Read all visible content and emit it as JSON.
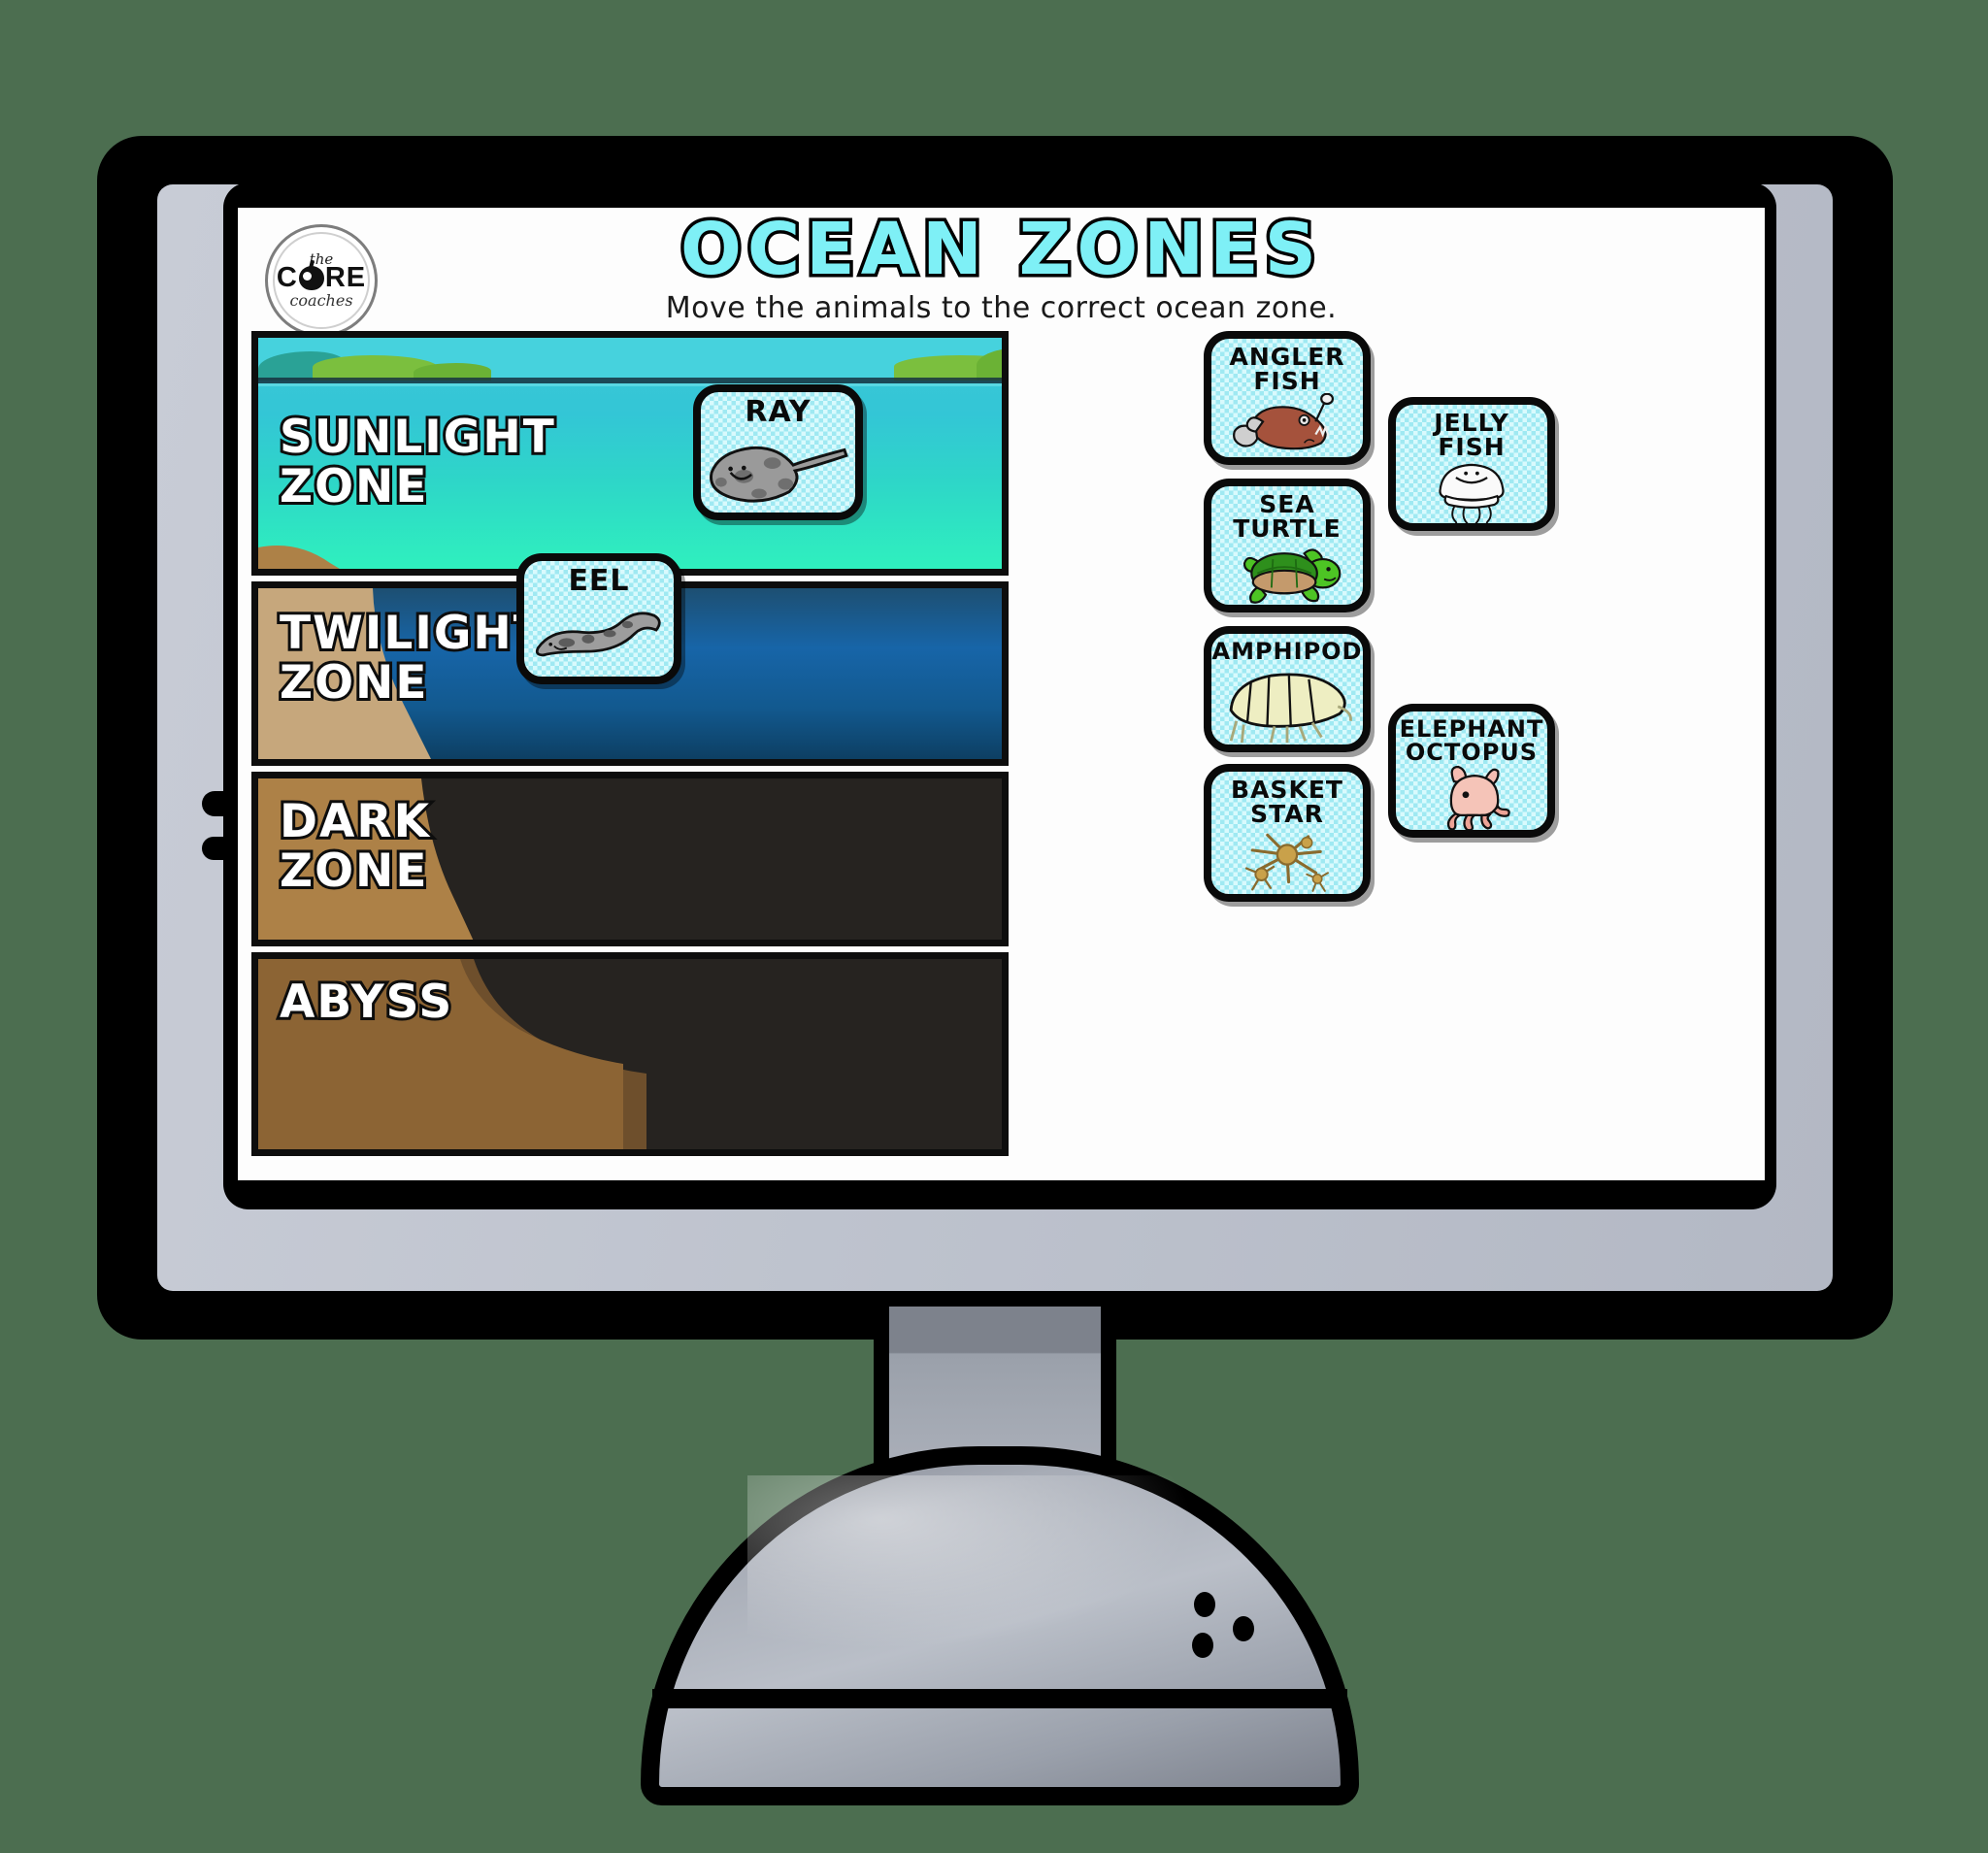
{
  "background_color": "#4c6e50",
  "monitor": {
    "frame_color": "#000000",
    "bezel_color": "#c3c8d2",
    "screen_color": "#fdfdfd"
  },
  "slide": {
    "logo": {
      "line_top": "the",
      "brand_left": "C",
      "brand_right": "RE",
      "line_bottom": "coaches",
      "icon": "apple-icon"
    },
    "title": "OCEAN ZONES",
    "title_color": "#7ef0f6",
    "subtitle": "Move the animals to the correct ocean zone.",
    "zones": [
      {
        "id": "sunlight",
        "label": "SUNLIGHT\nZONE",
        "color_top": "#3cc8d8",
        "color_bottom": "#2ff0be"
      },
      {
        "id": "twilight",
        "label": "TWILIGHT\nZONE",
        "color_top": "#1765a8",
        "color_bottom": "#0d3f63"
      },
      {
        "id": "dark",
        "label": "DARK\nZONE",
        "color_top": "#262320",
        "color_bottom": "#262320"
      },
      {
        "id": "abyss",
        "label": "ABYSS",
        "color_top": "#262320",
        "color_bottom": "#262320"
      }
    ],
    "placed_cards": [
      {
        "id": "ray",
        "label": "RAY",
        "zone": "sunlight"
      },
      {
        "id": "eel",
        "label": "EEL",
        "zone": "twilight"
      }
    ],
    "tray_cards": [
      {
        "id": "angler-fish",
        "label": "ANGLER FISH"
      },
      {
        "id": "sea-turtle",
        "label": "SEA TURTLE"
      },
      {
        "id": "amphipod",
        "label": "AMPHIPOD"
      },
      {
        "id": "basket-star",
        "label": "BASKET\nSTAR"
      },
      {
        "id": "jelly-fish",
        "label": "JELLY FISH"
      },
      {
        "id": "elephant-octopus",
        "label": "ELEPHANT\nOCTOPUS"
      }
    ],
    "card_background_color": "#9fe9f2",
    "card_border_color": "#0a0a0a"
  }
}
